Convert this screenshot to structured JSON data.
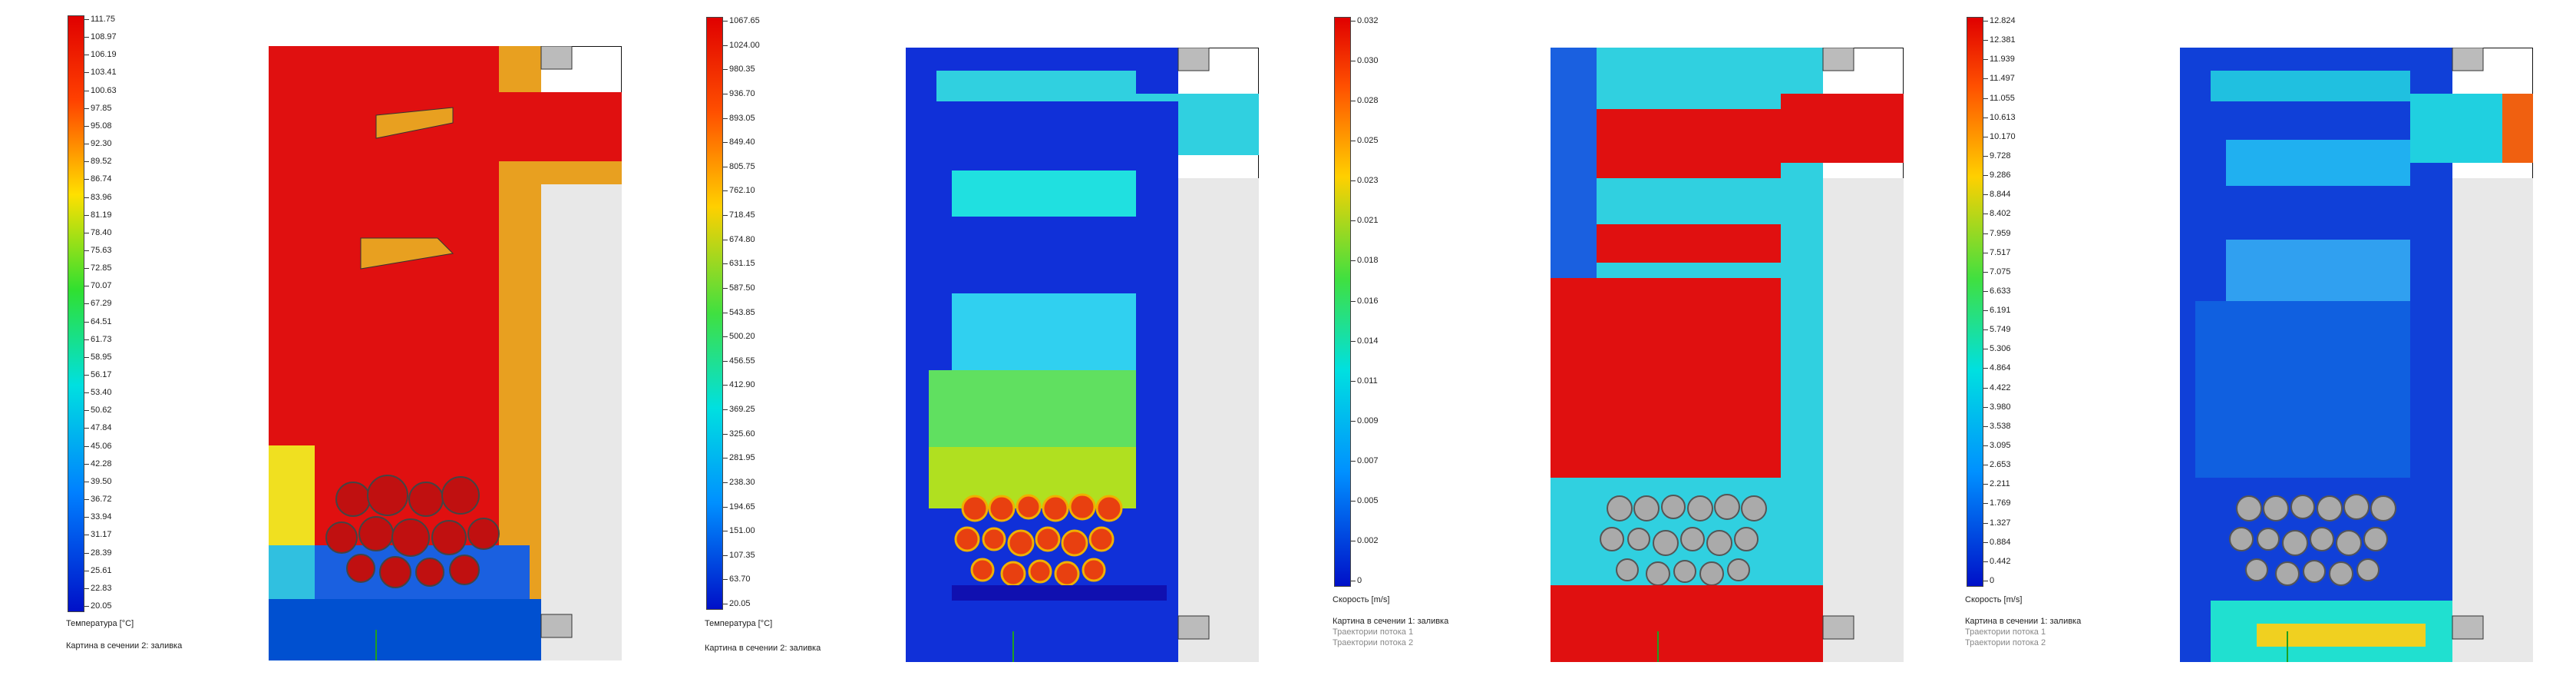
{
  "panels": [
    {
      "id": "temp_fill_1",
      "legend": {
        "ticks": [
          "111.75",
          "108.97",
          "106.19",
          "103.41",
          "100.63",
          "97.85",
          "95.08",
          "92.30",
          "89.52",
          "86.74",
          "83.96",
          "81.19",
          "78.40",
          "75.63",
          "72.85",
          "70.07",
          "67.29",
          "64.51",
          "61.73",
          "58.95",
          "56.17",
          "53.40",
          "50.62",
          "47.84",
          "45.06",
          "42.28",
          "39.50",
          "36.72",
          "33.94",
          "31.17",
          "28.39",
          "25.61",
          "22.83",
          "20.05"
        ],
        "label": "Температура [°C]"
      },
      "captions": [
        "Картина в сечении 2: заливка"
      ]
    },
    {
      "id": "temp_fill_2",
      "legend": {
        "ticks": [
          "1067.65",
          "1024.00",
          "980.35",
          "936.70",
          "893.05",
          "849.40",
          "805.75",
          "762.10",
          "718.45",
          "674.80",
          "631.15",
          "587.50",
          "543.85",
          "500.20",
          "456.55",
          "412.90",
          "369.25",
          "325.60",
          "281.95",
          "238.30",
          "194.65",
          "151.00",
          "107.35",
          "63.70",
          "20.05"
        ],
        "label": "Температура [°C]"
      },
      "captions": [
        "Картина в сечении 2: заливка"
      ]
    },
    {
      "id": "velocity_1",
      "legend": {
        "ticks": [
          "0.032",
          "0.030",
          "0.028",
          "0.025",
          "0.023",
          "0.021",
          "0.018",
          "0.016",
          "0.014",
          "0.011",
          "0.009",
          "0.007",
          "0.005",
          "0.002",
          "0"
        ],
        "label": "Скорость [m/s]"
      },
      "captions": [
        "Картина в сечении 1: заливка",
        "Траектории потока 1",
        "Траектории потока 2"
      ]
    },
    {
      "id": "velocity_2",
      "legend": {
        "ticks": [
          "12.824",
          "12.381",
          "11.939",
          "11.497",
          "11.055",
          "10.613",
          "10.170",
          "9.728",
          "9.286",
          "8.844",
          "8.402",
          "7.959",
          "7.517",
          "7.075",
          "6.633",
          "6.191",
          "5.749",
          "5.306",
          "4.864",
          "4.422",
          "3.980",
          "3.538",
          "3.095",
          "2.653",
          "2.211",
          "1.769",
          "1.327",
          "0.884",
          "0.442",
          "0"
        ],
        "label": "Скорость [m/s]"
      },
      "captions": [
        "Картина в сечении 1: заливка",
        "Траектории потока 1",
        "Траектории потока 2"
      ]
    }
  ]
}
